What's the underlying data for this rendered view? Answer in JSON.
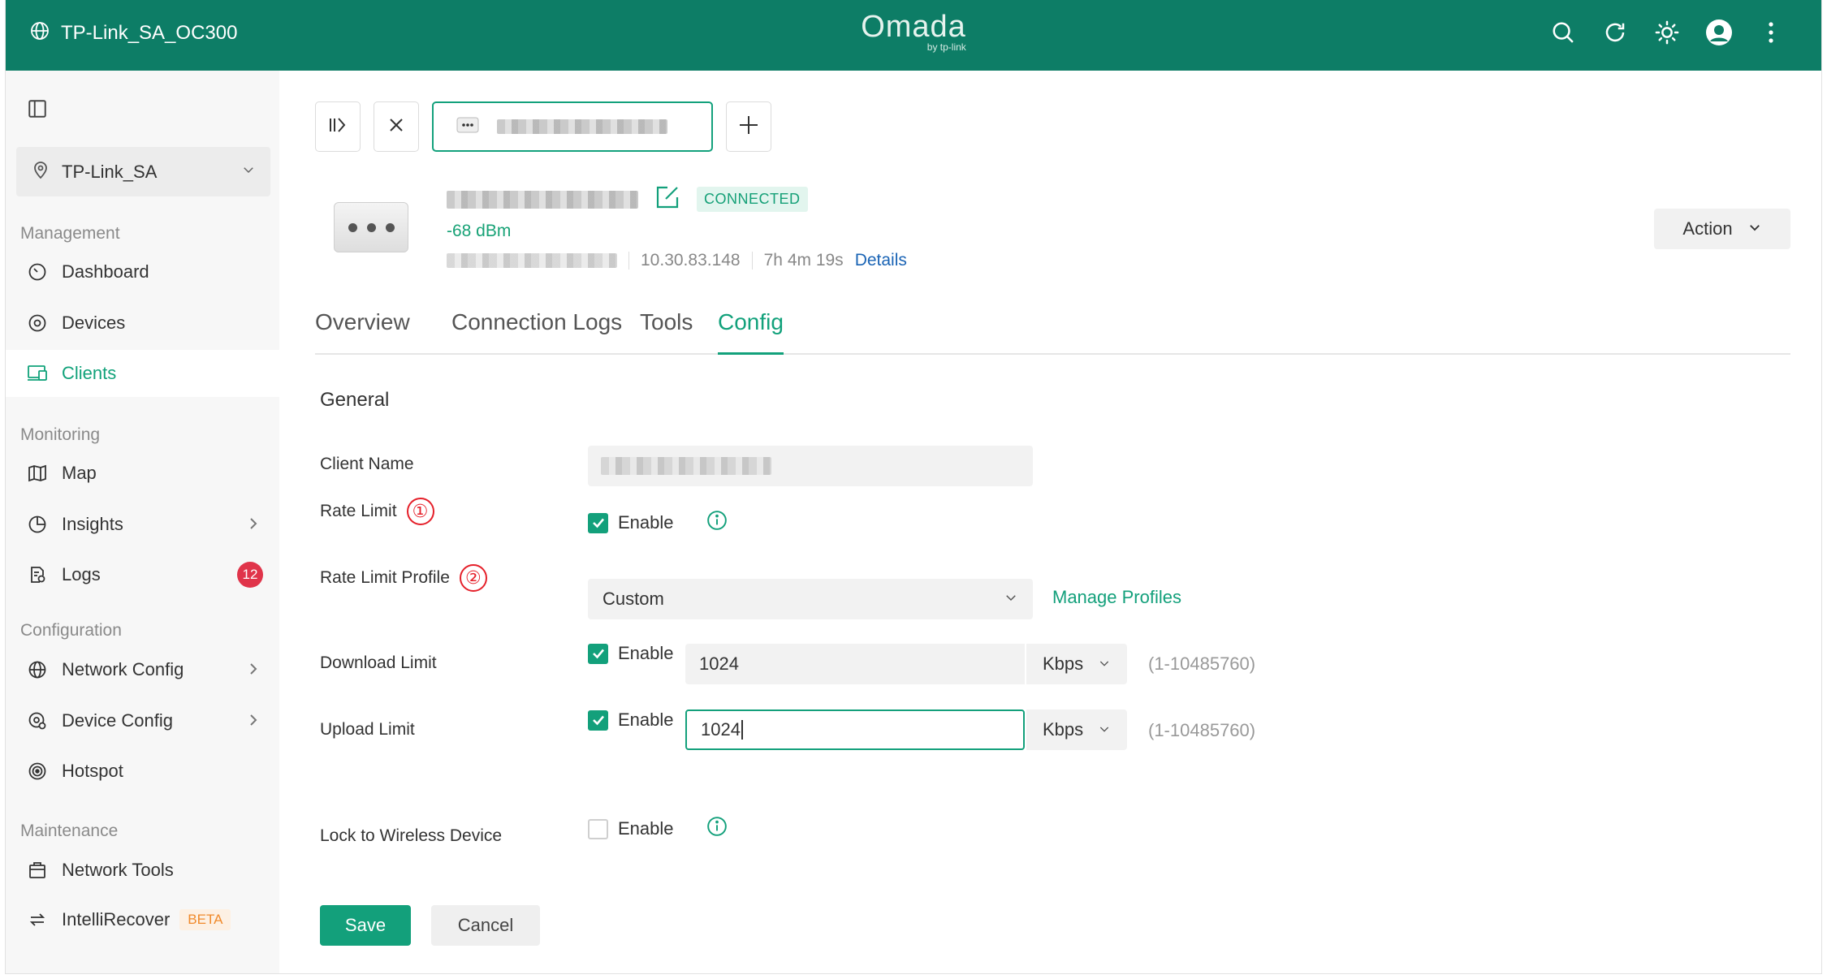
{
  "topbar": {
    "site_name": "TP-Link_SA_OC300",
    "logo_text": "Omada",
    "logo_sub": "by tp-link",
    "colors": {
      "bar": "#0d7d66",
      "accent": "#13a07b"
    }
  },
  "sidebar": {
    "site_selector": "TP-Link_SA",
    "sections": {
      "management": "Management",
      "monitoring": "Monitoring",
      "configuration": "Configuration",
      "maintenance": "Maintenance"
    },
    "items": {
      "dashboard": "Dashboard",
      "devices": "Devices",
      "clients": "Clients",
      "map": "Map",
      "insights": "Insights",
      "logs": "Logs",
      "logs_badge": "12",
      "network_config": "Network Config",
      "device_config": "Device Config",
      "hotspot": "Hotspot",
      "network_tools": "Network Tools",
      "intellirecover": "IntelliRecover",
      "beta": "BETA"
    }
  },
  "client": {
    "status": "CONNECTED",
    "signal": "-68 dBm",
    "ip": "10.30.83.148",
    "uptime": "7h 4m 19s",
    "details_link": "Details",
    "action_label": "Action"
  },
  "tabs": [
    "Overview",
    "Connection Logs",
    "Tools",
    "Config"
  ],
  "form": {
    "section_title": "General",
    "client_name_label": "Client Name",
    "rate_limit_label": "Rate Limit",
    "rate_limit_marker": "①",
    "rate_limit_profile_label": "Rate Limit Profile",
    "rate_limit_profile_marker": "②",
    "enable": "Enable",
    "profile_value": "Custom",
    "manage_profiles": "Manage Profiles",
    "download_label": "Download Limit",
    "download_value": "1024",
    "upload_label": "Upload Limit",
    "upload_value": "1024",
    "unit": "Kbps",
    "range_hint": "(1-10485760)",
    "lock_label": "Lock to Wireless Device",
    "save": "Save",
    "cancel": "Cancel"
  }
}
